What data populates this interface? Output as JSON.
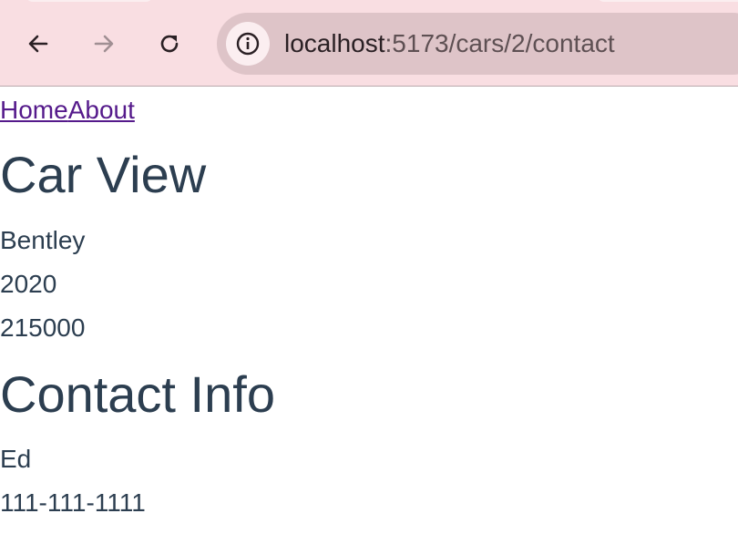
{
  "browser": {
    "url_host": "localhost",
    "url_path": ":5173/cars/2/contact",
    "icons": {
      "back": "arrow-left-icon",
      "forward": "arrow-right-icon",
      "reload": "reload-icon",
      "site_info": "info-icon"
    }
  },
  "nav": {
    "home_label": "Home",
    "about_label": "About"
  },
  "car_view": {
    "title": "Car View",
    "make": "Bentley",
    "year": "2020",
    "price": "215000"
  },
  "contact": {
    "title": "Contact Info",
    "name": "Ed",
    "phone": "111-111-1111"
  },
  "colors": {
    "chrome_bg": "#f9dee2",
    "omnibox_bg": "#dec4c8",
    "text": "#2c3e50",
    "visited_link": "#551a8b"
  }
}
